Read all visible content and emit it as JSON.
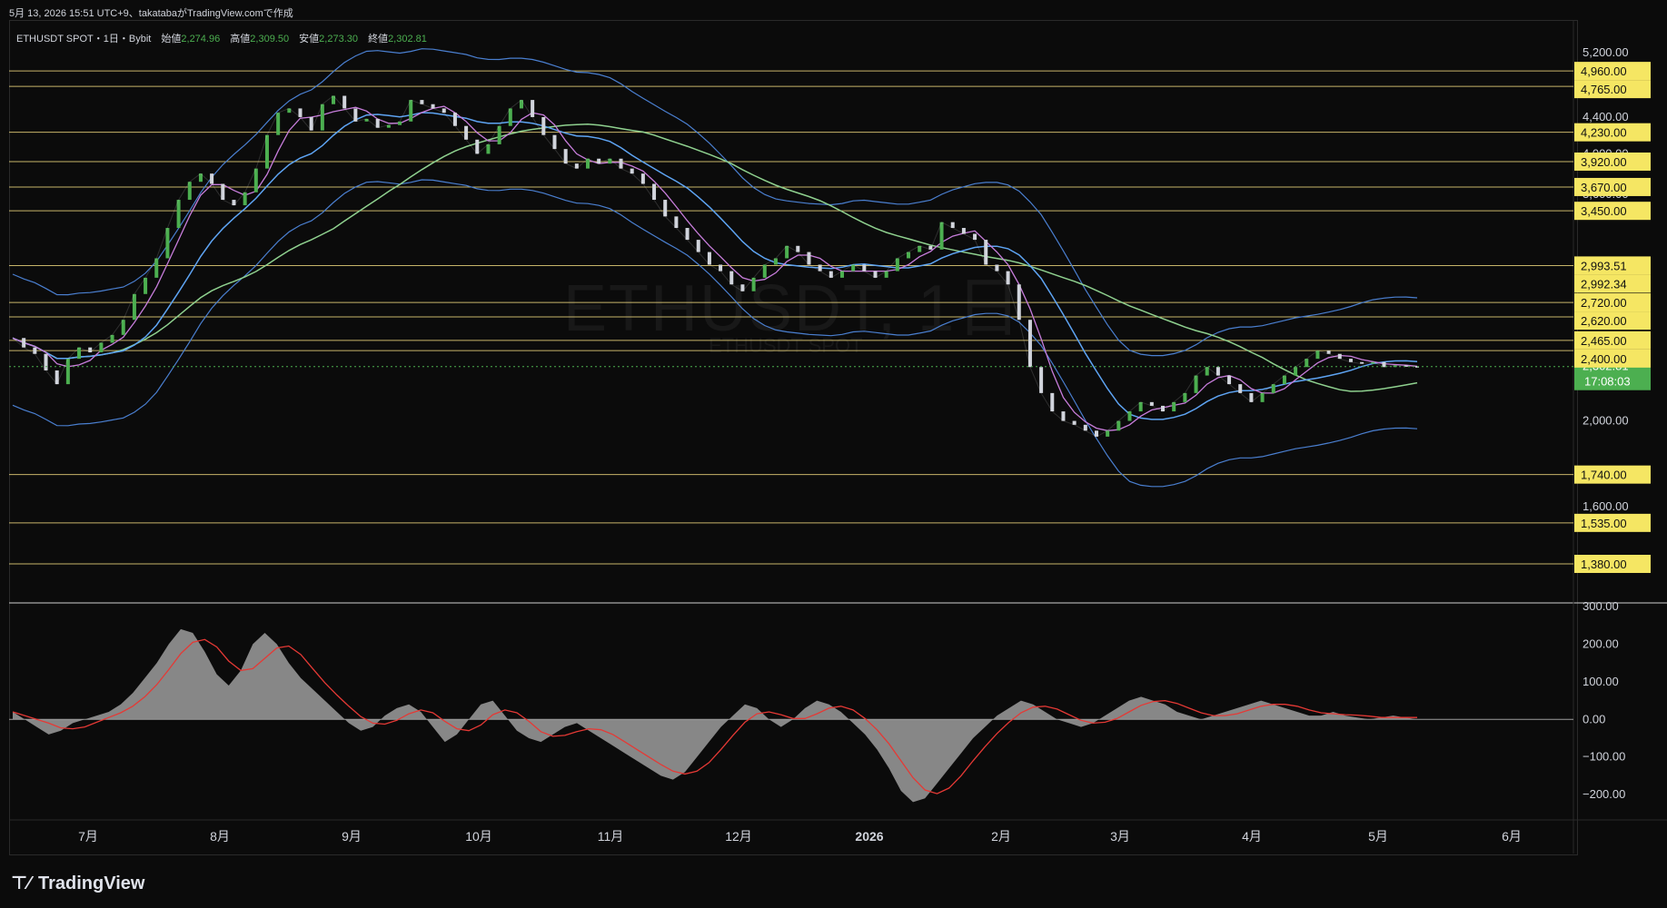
{
  "header_note": "5月 13, 2026 15:51 UTC+9、takatabaがTradingView.comで作成",
  "symbol_line": "ETHUSDT SPOT・1日・Bybit",
  "ohlc": {
    "open_label": "始値",
    "open": "2,274.96",
    "high_label": "高値",
    "high": "2,309.50",
    "low_label": "安値",
    "low": "2,273.30",
    "close_label": "終値",
    "close": "2,302.81"
  },
  "watermark": "ETHUSDT, 1日",
  "watermark_sub": "ETHUSDT SPOT",
  "brand": "TradingView",
  "colors": {
    "up": "#4caf50",
    "down": "#d1d4dc",
    "level": "#e8d27a",
    "price_tag": "#4caf50",
    "ma_fast": "#c77ddb",
    "ma_mid": "#5ea4f3",
    "ma_slow": "#8fd18f",
    "bb": "#4a7fd0",
    "macd_hist": "#9e9e9e",
    "macd_signal": "#e53935"
  },
  "chart_data": {
    "type": "line",
    "title": "ETHUSDT SPOT・1日・Bybit",
    "price_axis_ticks": [
      "5,200.00",
      "4,400.00",
      "4,000.00",
      "3,600.00",
      "2,000.00",
      "1,600.00"
    ],
    "price_tags": [
      {
        "value": 4960,
        "label": "4,960.00"
      },
      {
        "value": 4765,
        "label": "4,765.00"
      },
      {
        "value": 4230,
        "label": "4,230.00"
      },
      {
        "value": 3920,
        "label": "3,920.00"
      },
      {
        "value": 3670,
        "label": "3,670.00"
      },
      {
        "value": 3450,
        "label": "3,450.00"
      },
      {
        "value": 2993.51,
        "label": "2,993.51"
      },
      {
        "value": 2992.34,
        "label": "2,992.34"
      },
      {
        "value": 2720,
        "label": "2,720.00"
      },
      {
        "value": 2620,
        "label": "2,620.00"
      },
      {
        "value": 2465,
        "label": "2,465.00"
      },
      {
        "value": 2400,
        "label": "2,400.00"
      },
      {
        "value": 1740,
        "label": "1,740.00"
      },
      {
        "value": 1535,
        "label": "1,535.00"
      },
      {
        "value": 1380,
        "label": "1,380.00"
      }
    ],
    "horizontal_levels": [
      4960,
      4765,
      4230,
      3920,
      3670,
      3450,
      2993,
      2720,
      2620,
      2465,
      2400,
      1740,
      1535,
      1380
    ],
    "current_price": {
      "value": 2302.81,
      "label": "2,302.81",
      "countdown": "17:08:03"
    },
    "x_labels": [
      "7月",
      "8月",
      "9月",
      "10月",
      "11月",
      "12月",
      "2026",
      "2月",
      "3月",
      "4月",
      "5月",
      "6月"
    ],
    "close_series": [
      2480,
      2420,
      2380,
      2280,
      2200,
      2350,
      2420,
      2390,
      2450,
      2500,
      2600,
      2780,
      2900,
      3050,
      3300,
      3550,
      3720,
      3800,
      3700,
      3550,
      3500,
      3620,
      3850,
      4200,
      4450,
      4500,
      4400,
      4250,
      4550,
      4650,
      4500,
      4350,
      4380,
      4280,
      4310,
      4350,
      4600,
      4550,
      4500,
      4450,
      4300,
      4150,
      4000,
      4100,
      4300,
      4500,
      4600,
      4400,
      4200,
      4050,
      3900,
      3850,
      3950,
      3900,
      3950,
      3850,
      3800,
      3700,
      3550,
      3400,
      3300,
      3200,
      3100,
      3000,
      2950,
      2850,
      2800,
      2900,
      3000,
      3050,
      3150,
      3100,
      3000,
      2950,
      2900,
      2950,
      3000,
      2950,
      2900,
      2950,
      3050,
      3100,
      3150,
      3120,
      3350,
      3300,
      3250,
      3200,
      3000,
      2950,
      2850,
      2600,
      2300,
      2150,
      2050,
      2000,
      1980,
      1950,
      1920,
      1950,
      2000,
      2050,
      2100,
      2080,
      2050,
      2100,
      2150,
      2250,
      2300,
      2250,
      2200,
      2150,
      2100,
      2150,
      2200,
      2250,
      2300,
      2350,
      2400,
      2380,
      2350,
      2330,
      2320,
      2330,
      2300,
      2310,
      2305,
      2303
    ],
    "macd_axis_ticks": [
      "300.00",
      "200.00",
      "100.00",
      "0.00",
      "−100.00",
      "−200.00"
    ],
    "macd_hist": [
      20,
      0,
      -20,
      -40,
      -30,
      -10,
      0,
      10,
      20,
      40,
      70,
      110,
      150,
      200,
      240,
      230,
      180,
      120,
      90,
      130,
      200,
      230,
      200,
      150,
      110,
      80,
      50,
      20,
      -10,
      -30,
      -20,
      10,
      30,
      40,
      20,
      -20,
      -60,
      -40,
      0,
      40,
      50,
      10,
      -30,
      -50,
      -60,
      -40,
      -20,
      -10,
      -30,
      -50,
      -70,
      -90,
      -110,
      -130,
      -150,
      -160,
      -140,
      -100,
      -60,
      -20,
      10,
      40,
      30,
      0,
      -20,
      0,
      30,
      50,
      40,
      20,
      -10,
      -40,
      -80,
      -130,
      -190,
      -220,
      -210,
      -170,
      -130,
      -90,
      -50,
      -20,
      10,
      30,
      50,
      40,
      20,
      0,
      -10,
      -20,
      -10,
      10,
      30,
      50,
      60,
      50,
      40,
      20,
      10,
      0,
      10,
      20,
      30,
      40,
      50,
      40,
      30,
      20,
      10,
      10,
      20,
      10,
      5,
      0,
      5,
      10,
      5,
      0
    ]
  }
}
